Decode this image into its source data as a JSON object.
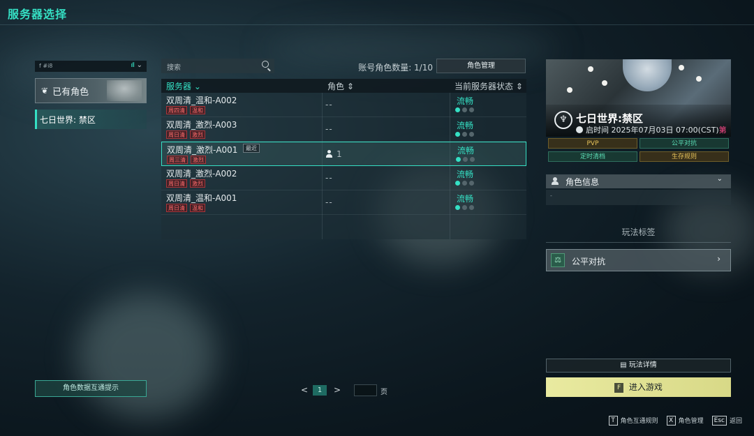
{
  "header": {
    "title": "服务器选择"
  },
  "left": {
    "signal_text": "f #i8",
    "has_role_label": "已有角色",
    "world_item": "七日世界: 禁区",
    "data_hint_button": "角色数据互通提示"
  },
  "toolbar": {
    "search_placeholder": "搜索",
    "role_count": "账号角色数量: 1/10",
    "role_manage_button": "角色管理"
  },
  "table": {
    "headers": {
      "server": "服务器",
      "role": "角色",
      "status": "当前服务器状态"
    },
    "rows": [
      {
        "name": "双周清_温和-A002",
        "tags": [
          "周四清",
          "温和"
        ],
        "role": "--",
        "status": "流畅",
        "load": 1,
        "recent": ""
      },
      {
        "name": "双周清_激烈-A003",
        "tags": [
          "周日清",
          "激烈"
        ],
        "role": "--",
        "status": "流畅",
        "load": 1,
        "recent": ""
      },
      {
        "name": "双周清_激烈-A001",
        "tags": [
          "周三清",
          "激烈"
        ],
        "role": "1",
        "status": "流畅",
        "load": 1,
        "recent": "最近"
      },
      {
        "name": "双周清_激烈-A002",
        "tags": [
          "周日清",
          "激烈"
        ],
        "role": "--",
        "status": "流畅",
        "load": 1,
        "recent": ""
      },
      {
        "name": "双周清_温和-A001",
        "tags": [
          "周日清",
          "温和"
        ],
        "role": "--",
        "status": "流畅",
        "load": 1,
        "recent": ""
      }
    ]
  },
  "pager": {
    "current": "1",
    "unit": "页"
  },
  "right": {
    "world_name": "七日世界:禁区",
    "open_time": "启时间 2025年07月03日 07:00(CST)",
    "open_time_suffix": "第",
    "game_tags": [
      "PVP",
      "公平对抗",
      "定时清档",
      "生存规则"
    ],
    "role_info_label": "角色信息",
    "play_tags_title": "玩法标签",
    "fair_label": "公平对抗",
    "play_detail_button": "玩法详情",
    "enter_button": "进入游戏",
    "enter_key": "F"
  },
  "hints": [
    {
      "key": "T",
      "label": "角色互通规则"
    },
    {
      "key": "X",
      "label": "角色管理"
    },
    {
      "key": "Esc",
      "label": "返回"
    }
  ],
  "colors": {
    "accent": "#35e0c4",
    "tag_red": "#ff6a6a",
    "enter_yellow": "#e9eaa0"
  }
}
